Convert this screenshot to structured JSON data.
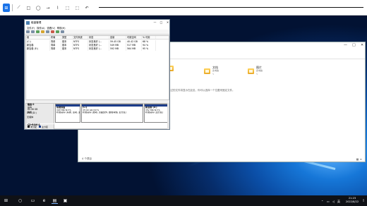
{
  "topbar": {
    "tools": [
      "⊞",
      "⟋",
      "□",
      "◯",
      "→",
      "⌇",
      "⬚",
      "⬚",
      "↶"
    ],
    "active_index": 0
  },
  "explorer": {
    "quick_access": [
      {
        "name": "文档",
        "sub": "此电脑"
      },
      {
        "name": "图片",
        "sub": "此电脑"
      }
    ],
    "hint": "你使用过的文件将显示在此处，你可以选择一个位置来固定文件。",
    "status": "4 个项目"
  },
  "diskmgmt": {
    "title": "磁盘管理",
    "menu": [
      "文件(F)",
      "操作(A)",
      "查看(V)",
      "帮助(H)"
    ],
    "columns": [
      "卷",
      "布局",
      "类型",
      "文件系统",
      "状态",
      "容量",
      "可用空间",
      "% 可用"
    ],
    "rows": [
      [
        "(C:)",
        "简单",
        "基本",
        "NTFS",
        "状态良好 (...",
        "59.45 GB",
        "40.42 GB",
        "68 %"
      ],
      [
        "新加卷",
        "简单",
        "基本",
        "NTFS",
        "状态良好 (...",
        "549 MB",
        "517 MB",
        "94 %"
      ],
      [
        "新加卷 (E:)",
        "简单",
        "基本",
        "NTFS",
        "状态良好 (...",
        "592 MB",
        "564 MB",
        "95 %"
      ]
    ],
    "disk0": {
      "name": "磁盘 0",
      "type": "基本",
      "size": "60.98 GB",
      "status": "联机",
      "parts": [
        {
          "label": "系统保留",
          "size": "549 MB NTFS",
          "status": "状态良好 (系统, 活动, 主分区)"
        },
        {
          "label": "(C:)",
          "size": "59.45 GB NTFS",
          "status": "状态良好 (启动, 页面文件, 故障转储, 主分区)"
        },
        {
          "label": "新加卷 (E:)",
          "size": "592 MB NTFS",
          "status": "状态良好 (主分区)"
        }
      ]
    },
    "cdrom": {
      "name": "CD-ROM 0",
      "type": "DVD (D:)",
      "status": "无媒体"
    },
    "legend": [
      "未分配",
      "主分区"
    ]
  },
  "taskbar": {
    "time": "21:23",
    "date": "2022/8/22",
    "ime": "英"
  },
  "colors": {
    "accent": "#1a73e8",
    "partition_bar": "#1b3c8a",
    "taskbar": "#0f1116"
  }
}
